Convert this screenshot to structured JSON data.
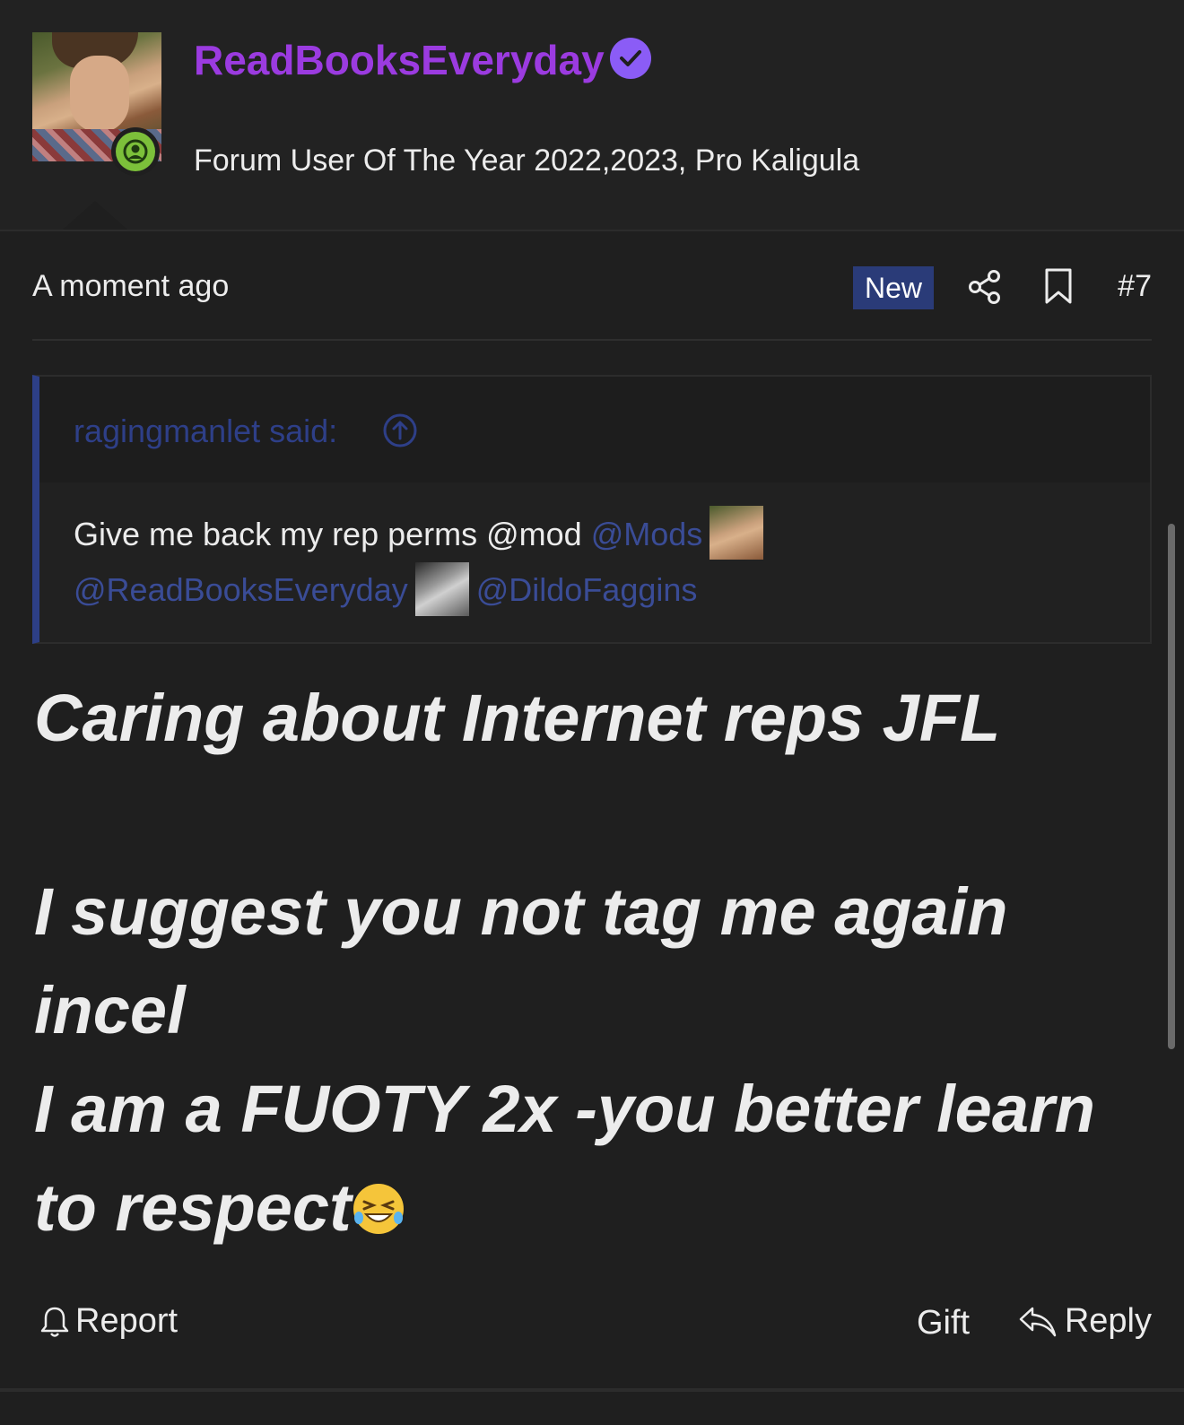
{
  "user": {
    "username": "ReadBooksEveryday",
    "title": "Forum User Of The Year 2022,2023, Pro Kaligula"
  },
  "meta": {
    "timestamp": "A moment ago",
    "badge": "New",
    "post_number": "#7"
  },
  "quote": {
    "author": "ragingmanlet said:",
    "text_prefix": "Give me back my rep perms @mod",
    "mentions": [
      "@Mods",
      "@ReadBooksEveryday",
      "@DildoFaggins"
    ]
  },
  "post": {
    "lines": [
      "Caring about Internet reps JFL",
      "I suggest you not tag me again",
      "incel",
      "I am a FUOTY 2x -you better learn",
      "to respect"
    ],
    "emoji": "crying-laughing-emoji"
  },
  "footer": {
    "report": "Report",
    "gift": "Gift",
    "reply": "Reply"
  },
  "colors": {
    "background": "#1f1f1f",
    "username": "#9b3be0",
    "accent_blue": "#2a3b78",
    "mention": "#3a4c96",
    "online": "#7cc03a"
  }
}
